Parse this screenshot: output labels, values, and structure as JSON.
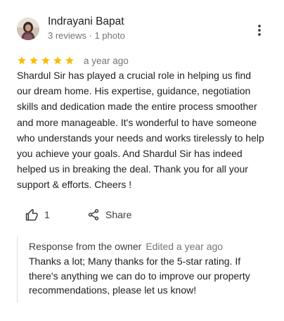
{
  "reviewer": {
    "name": "Indrayani Bapat",
    "meta": "3 reviews · 1 photo"
  },
  "rating": {
    "stars": 5,
    "max": 5,
    "date": "a year ago",
    "star_color": "#fbbc04"
  },
  "review": {
    "text": "Shardul Sir has played a crucial role in helping us find our dream home. His expertise, guidance, negotiation skills and dedication made the entire process smoother and more manageable. It's wonderful to have someone who understands your needs and works tirelessly to help you achieve your goals. And Shardul Sir has indeed helped us in breaking the deal. Thank you for all your support & efforts. Cheers !"
  },
  "actions": {
    "like_count": "1",
    "share_label": "Share"
  },
  "owner_response": {
    "title": "Response from the owner",
    "date": "Edited a year ago",
    "text": "Thanks a lot; Many thanks for the 5-star rating. If there's anything we can do to improve our property recommendations, please let us know!"
  },
  "icons": {
    "more": "more-vert-icon",
    "like": "thumb-up-icon",
    "share": "share-icon",
    "star": "star-icon"
  }
}
